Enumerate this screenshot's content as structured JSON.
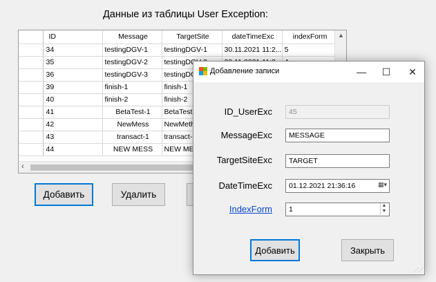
{
  "window": {
    "title": "Данные из таблицы User Exception:"
  },
  "grid": {
    "columns": [
      "ID",
      "Message",
      "TargetSite",
      "dateTimeExc",
      "indexForm"
    ],
    "rows": [
      [
        "34",
        "testingDGV-1",
        "testingDGV-1",
        "30.11.2021 11:2...",
        "5"
      ],
      [
        "35",
        "testingDGV-2",
        "testingDGV-2",
        "30.11.2021 11:2...",
        "4"
      ],
      [
        "36",
        "testingDGV-3",
        "testingDG",
        "",
        ""
      ],
      [
        "39",
        "finish-1",
        "finish-1",
        "",
        ""
      ],
      [
        "40",
        "finish-2",
        "finish-2",
        "",
        ""
      ],
      [
        "41",
        "BetaTest-1",
        "BetaTest",
        "",
        ""
      ],
      [
        "42",
        "NewMess",
        "NewMeth",
        "",
        ""
      ],
      [
        "43",
        "transact-1",
        "transact-",
        "",
        ""
      ],
      [
        "44",
        "NEW MESS",
        "NEW ME",
        "",
        ""
      ]
    ]
  },
  "main_buttons": {
    "add": "Добавить",
    "delete": "Удалить"
  },
  "dialog": {
    "title": "Добавление записи",
    "labels": {
      "id": "ID_UserExc",
      "message": "MessageExc",
      "target": "TargetSiteExc",
      "datetime": "DateTimeExc",
      "index": "IndexForm"
    },
    "values": {
      "id": "45",
      "message": "MESSAGE",
      "target": "TARGET",
      "datetime": "01.12.2021 21:36:16",
      "index": "1"
    },
    "buttons": {
      "add": "Добавить",
      "close": "Закрыть"
    },
    "controls": {
      "minimize": "—",
      "maximize": "☐",
      "close": "✕"
    }
  },
  "colors": {
    "accent": "#0078d7",
    "link": "#0645d2"
  }
}
